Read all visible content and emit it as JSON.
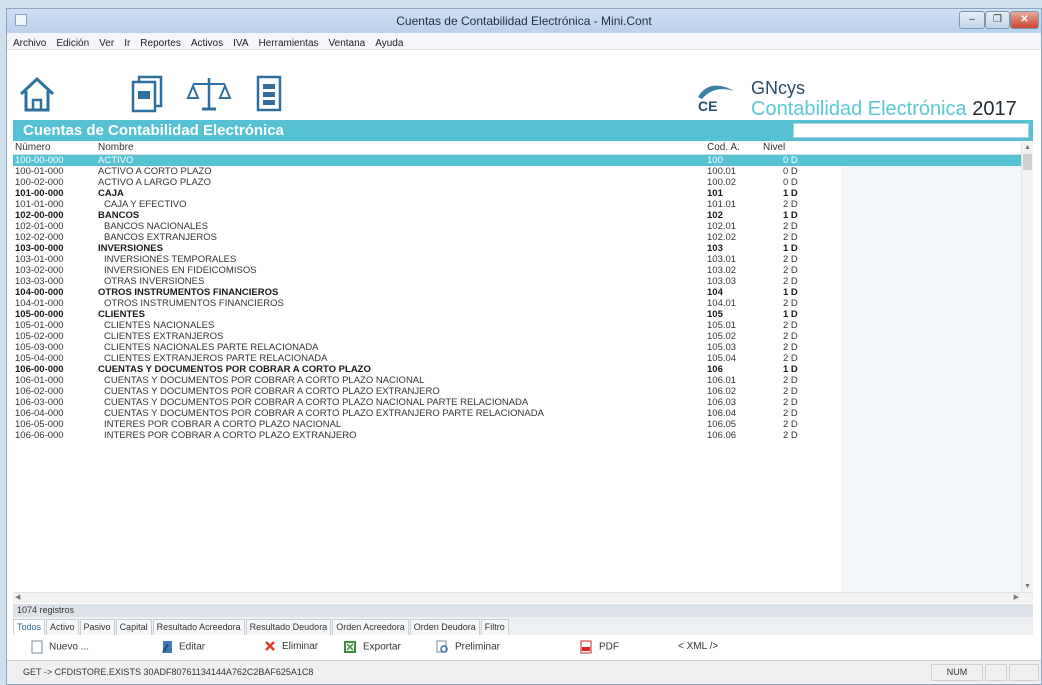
{
  "window": {
    "title": "Cuentas de Contabilidad Electrónica - Mini.Cont",
    "min_glyph": "–",
    "max_glyph": "❐",
    "close_glyph": "✕"
  },
  "menu": [
    "Archivo",
    "Edición",
    "Ver",
    "Ir",
    "Reportes",
    "Activos",
    "IVA",
    "Herramientas",
    "Ventana",
    "Ayuda"
  ],
  "toolbar_icons": [
    "home-icon",
    "documents-icon",
    "balance-scale-icon",
    "report-icon"
  ],
  "brand": {
    "badge": "CE",
    "name": "GNcys",
    "product": "Contabilidad Electrónica",
    "year": "2017"
  },
  "section": {
    "title": "Cuentas de Contabilidad Electrónica",
    "search_value": ""
  },
  "grid": {
    "headers": [
      "Número",
      "Nombre",
      "Cod. A.",
      "Nivel"
    ],
    "rows": [
      {
        "num": "100-00-000",
        "name": "ACTIVO",
        "cod": "100",
        "nivel": "0 D",
        "bold": false,
        "selected": true
      },
      {
        "num": "100-01-000",
        "name": "ACTIVO A CORTO PLAZO",
        "cod": "100.01",
        "nivel": "0 D",
        "bold": false
      },
      {
        "num": "100-02-000",
        "name": "ACTIVO A LARGO PLAZO",
        "cod": "100.02",
        "nivel": "0 D",
        "bold": false
      },
      {
        "num": "101-00-000",
        "name": "CAJA",
        "cod": "101",
        "nivel": "1 D",
        "bold": true
      },
      {
        "num": "101-01-000",
        "name": "CAJA Y EFECTIVO",
        "cod": "101.01",
        "nivel": "2 D",
        "bold": false
      },
      {
        "num": "102-00-000",
        "name": "BANCOS",
        "cod": "102",
        "nivel": "1 D",
        "bold": true
      },
      {
        "num": "102-01-000",
        "name": "BANCOS NACIONALES",
        "cod": "102.01",
        "nivel": "2 D",
        "bold": false
      },
      {
        "num": "102-02-000",
        "name": "BANCOS EXTRANJEROS",
        "cod": "102.02",
        "nivel": "2 D",
        "bold": false
      },
      {
        "num": "103-00-000",
        "name": "INVERSIONES",
        "cod": "103",
        "nivel": "1 D",
        "bold": true
      },
      {
        "num": "103-01-000",
        "name": "INVERSIONES TEMPORALES",
        "cod": "103.01",
        "nivel": "2 D",
        "bold": false
      },
      {
        "num": "103-02-000",
        "name": "INVERSIONES EN FIDEICOMISOS",
        "cod": "103.02",
        "nivel": "2 D",
        "bold": false
      },
      {
        "num": "103-03-000",
        "name": "OTRAS INVERSIONES",
        "cod": "103.03",
        "nivel": "2 D",
        "bold": false
      },
      {
        "num": "104-00-000",
        "name": "OTROS INSTRUMENTOS FINANCIEROS",
        "cod": "104",
        "nivel": "1 D",
        "bold": true
      },
      {
        "num": "104-01-000",
        "name": "OTROS INSTRUMENTOS FINANCIEROS",
        "cod": "104.01",
        "nivel": "2 D",
        "bold": false
      },
      {
        "num": "105-00-000",
        "name": "CLIENTES",
        "cod": "105",
        "nivel": "1 D",
        "bold": true
      },
      {
        "num": "105-01-000",
        "name": "CLIENTES NACIONALES",
        "cod": "105.01",
        "nivel": "2 D",
        "bold": false
      },
      {
        "num": "105-02-000",
        "name": "CLIENTES EXTRANJEROS",
        "cod": "105.02",
        "nivel": "2 D",
        "bold": false
      },
      {
        "num": "105-03-000",
        "name": "CLIENTES NACIONALES PARTE RELACIONADA",
        "cod": "105.03",
        "nivel": "2 D",
        "bold": false
      },
      {
        "num": "105-04-000",
        "name": "CLIENTES EXTRANJEROS PARTE RELACIONADA",
        "cod": "105.04",
        "nivel": "2 D",
        "bold": false
      },
      {
        "num": "106-00-000",
        "name": "CUENTAS Y DOCUMENTOS POR COBRAR A CORTO PLAZO",
        "cod": "106",
        "nivel": "1 D",
        "bold": true
      },
      {
        "num": "106-01-000",
        "name": "CUENTAS Y DOCUMENTOS POR COBRAR A CORTO PLAZO NACIONAL",
        "cod": "106.01",
        "nivel": "2 D",
        "bold": false
      },
      {
        "num": "106-02-000",
        "name": "CUENTAS Y DOCUMENTOS POR COBRAR A CORTO PLAZO EXTRANJERO",
        "cod": "106.02",
        "nivel": "2 D",
        "bold": false
      },
      {
        "num": "106-03-000",
        "name": "CUENTAS Y DOCUMENTOS POR COBRAR A CORTO PLAZO NACIONAL PARTE RELACIONADA",
        "cod": "106.03",
        "nivel": "2 D",
        "bold": false
      },
      {
        "num": "106-04-000",
        "name": "CUENTAS Y DOCUMENTOS POR COBRAR A CORTO PLAZO EXTRANJERO PARTE RELACIONADA",
        "cod": "106.04",
        "nivel": "2 D",
        "bold": false
      },
      {
        "num": "106-05-000",
        "name": "INTERES POR COBRAR A CORTO PLAZO NACIONAL",
        "cod": "106.05",
        "nivel": "2 D",
        "bold": false
      },
      {
        "num": "106-06-000",
        "name": "INTERES POR COBRAR A CORTO PLAZO EXTRANJERO",
        "cod": "106.06",
        "nivel": "2 D",
        "bold": false
      }
    ]
  },
  "record_count": "1074 registros",
  "tabs": [
    "Todos",
    "Activo",
    "Pasivo",
    "Capital",
    "Resultado Acreedora",
    "Resultado Deudora",
    "Orden Acreedora",
    "Orden Deudora",
    "Filtro"
  ],
  "actions": [
    {
      "label": "Nuevo ...",
      "icon": "new-document-icon"
    },
    {
      "label": "Editar",
      "icon": "edit-icon"
    },
    {
      "label": "Eliminar",
      "icon": "delete-icon"
    },
    {
      "label": "Exportar",
      "icon": "export-icon"
    },
    {
      "label": "Preliminar",
      "icon": "print-preview-icon"
    },
    {
      "label": "PDF",
      "icon": "pdf-icon"
    },
    {
      "label": "< XML />",
      "icon": ""
    }
  ],
  "status": {
    "text": "GET -> CFDISTORE.EXISTS 30ADF80761134144A762C2BAF625A1C8",
    "num": "NUM"
  },
  "colors": {
    "accent": "#55c1d2",
    "selected_row": "#56c2d2",
    "brand_dark": "#284b66"
  }
}
